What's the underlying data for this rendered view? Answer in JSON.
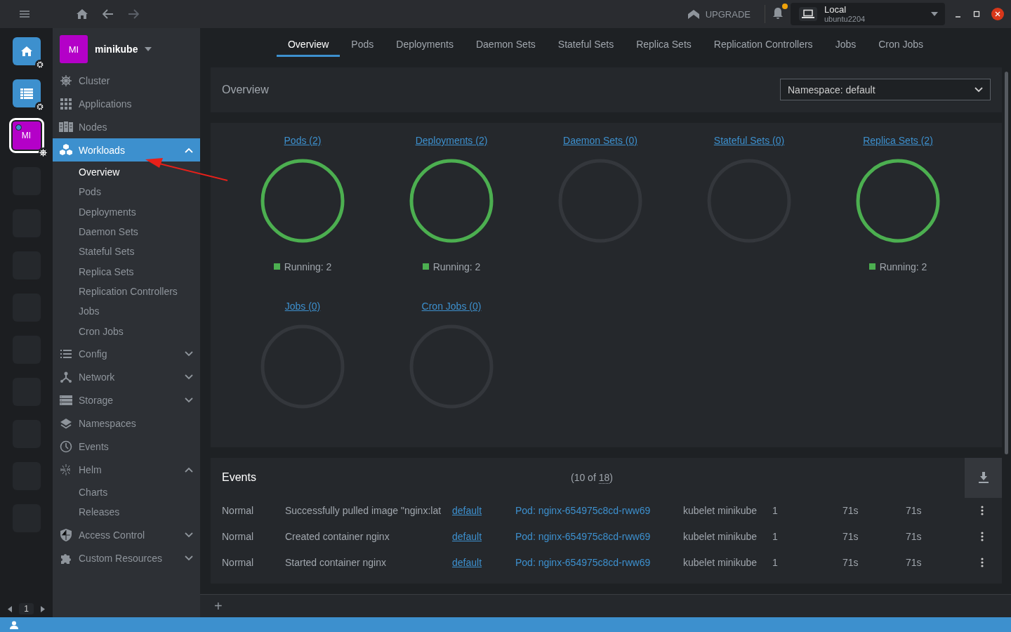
{
  "topbar": {
    "upgrade": "UPGRADE",
    "notifications": {
      "unread": true
    },
    "context": {
      "name": "Local",
      "host": "ubuntu2204"
    }
  },
  "hotbar": {
    "items": [
      {
        "kind": "home",
        "selected": false
      },
      {
        "kind": "catalog",
        "selected": false
      },
      {
        "kind": "cluster",
        "label": "MI",
        "color": "#b400c8",
        "selected": true
      },
      {
        "kind": "empty",
        "selected": false
      },
      {
        "kind": "empty",
        "selected": false
      },
      {
        "kind": "empty",
        "selected": false
      },
      {
        "kind": "empty",
        "selected": false
      },
      {
        "kind": "empty",
        "selected": false
      },
      {
        "kind": "empty",
        "selected": false
      },
      {
        "kind": "empty",
        "selected": false
      },
      {
        "kind": "empty",
        "selected": false
      },
      {
        "kind": "empty",
        "selected": false
      }
    ],
    "page": "1"
  },
  "cluster": {
    "avatar": "MI",
    "color": "#b400c8",
    "name": "minikube"
  },
  "sidebar": {
    "items": [
      {
        "label": "Cluster",
        "selected": false
      },
      {
        "label": "Applications",
        "selected": false
      },
      {
        "label": "Nodes",
        "selected": false
      },
      {
        "label": "Workloads",
        "selected": true,
        "expanded": true,
        "children": [
          {
            "label": "Overview",
            "selected": true
          },
          {
            "label": "Pods",
            "selected": false
          },
          {
            "label": "Deployments",
            "selected": false
          },
          {
            "label": "Daemon Sets",
            "selected": false
          },
          {
            "label": "Stateful Sets",
            "selected": false
          },
          {
            "label": "Replica Sets",
            "selected": false
          },
          {
            "label": "Replication Controllers",
            "selected": false
          },
          {
            "label": "Jobs",
            "selected": false
          },
          {
            "label": "Cron Jobs",
            "selected": false
          }
        ]
      },
      {
        "label": "Config",
        "selected": false,
        "expanded": false
      },
      {
        "label": "Network",
        "selected": false,
        "expanded": false
      },
      {
        "label": "Storage",
        "selected": false,
        "expanded": false
      },
      {
        "label": "Namespaces",
        "selected": false
      },
      {
        "label": "Events",
        "selected": false
      },
      {
        "label": "Helm",
        "selected": false,
        "expanded": true,
        "children": [
          {
            "label": "Charts",
            "selected": false
          },
          {
            "label": "Releases",
            "selected": false
          }
        ]
      },
      {
        "label": "Access Control",
        "selected": false,
        "expanded": false
      },
      {
        "label": "Custom Resources",
        "selected": false,
        "expanded": false
      }
    ]
  },
  "tabs": [
    {
      "label": "Overview",
      "selected": true
    },
    {
      "label": "Pods",
      "selected": false
    },
    {
      "label": "Deployments",
      "selected": false
    },
    {
      "label": "Daemon Sets",
      "selected": false
    },
    {
      "label": "Stateful Sets",
      "selected": false
    },
    {
      "label": "Replica Sets",
      "selected": false
    },
    {
      "label": "Replication Controllers",
      "selected": false
    },
    {
      "label": "Jobs",
      "selected": false
    },
    {
      "label": "Cron Jobs",
      "selected": false
    }
  ],
  "overview": {
    "title": "Overview",
    "namespace": "Namespace: default"
  },
  "workloads": [
    {
      "title": "Pods (2)",
      "running": true,
      "legend": "Running: 2"
    },
    {
      "title": "Deployments (2)",
      "running": true,
      "legend": "Running: 2"
    },
    {
      "title": "Daemon Sets (0)",
      "running": false
    },
    {
      "title": "Stateful Sets (0)",
      "running": false
    },
    {
      "title": "Replica Sets (2)",
      "running": true,
      "legend": "Running: 2"
    },
    {
      "title": "Jobs (0)",
      "running": false
    },
    {
      "title": "Cron Jobs (0)",
      "running": false
    }
  ],
  "events": {
    "title": "Events",
    "count_prefix": "(10 of ",
    "count_total": "18",
    "count_suffix": ")",
    "rows": [
      {
        "type": "Normal",
        "message": "Successfully pulled image \"nginx:lat",
        "namespace": "default",
        "object": "Pod: nginx-654975c8cd-rww69",
        "source": "kubelet minikube",
        "count": "1",
        "age": "71s",
        "last_seen": "71s"
      },
      {
        "type": "Normal",
        "message": "Created container nginx",
        "namespace": "default",
        "object": "Pod: nginx-654975c8cd-rww69",
        "source": "kubelet minikube",
        "count": "1",
        "age": "71s",
        "last_seen": "71s"
      },
      {
        "type": "Normal",
        "message": "Started container nginx",
        "namespace": "default",
        "object": "Pod: nginx-654975c8cd-rww69",
        "source": "kubelet minikube",
        "count": "1",
        "age": "71s",
        "last_seen": "71s"
      }
    ]
  },
  "dock": {
    "add": "+"
  }
}
